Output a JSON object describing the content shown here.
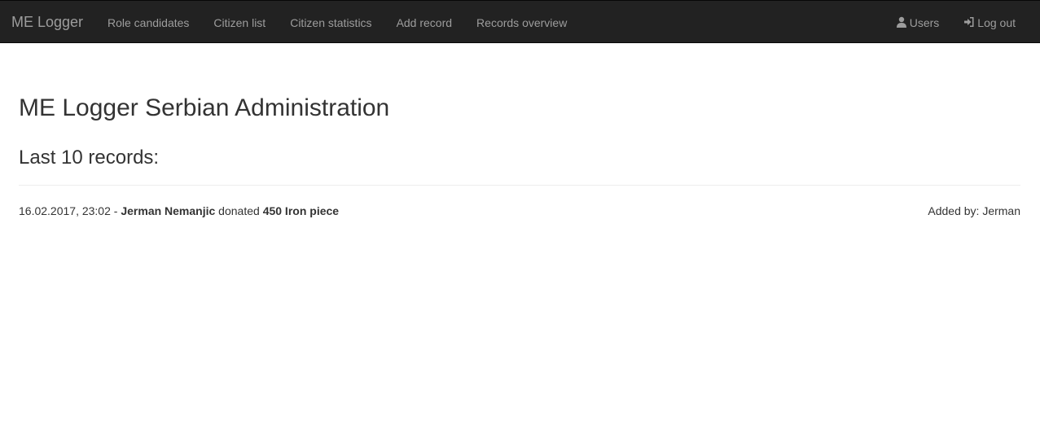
{
  "navbar": {
    "brand": "ME Logger",
    "left_items": [
      {
        "label": "Role candidates"
      },
      {
        "label": "Citizen list"
      },
      {
        "label": "Citizen statistics"
      },
      {
        "label": "Add record"
      },
      {
        "label": "Records overview"
      }
    ],
    "right_items": [
      {
        "label": "Users",
        "icon": "user-icon"
      },
      {
        "label": "Log out",
        "icon": "log-out-icon"
      }
    ]
  },
  "main": {
    "title": "ME Logger Serbian Administration",
    "records_heading": "Last 10 records:",
    "records": [
      {
        "timestamp": "16.02.2017, 23:02",
        "separator": " - ",
        "citizen": "Jerman Nemanjic",
        "action": " donated ",
        "item": "450 Iron piece",
        "added_by": "Added by: Jerman"
      }
    ]
  },
  "colors": {
    "navbar_bg": "#222222",
    "nav_text": "#9d9d9d",
    "body_text": "#333333",
    "divider": "#eeeeee"
  }
}
